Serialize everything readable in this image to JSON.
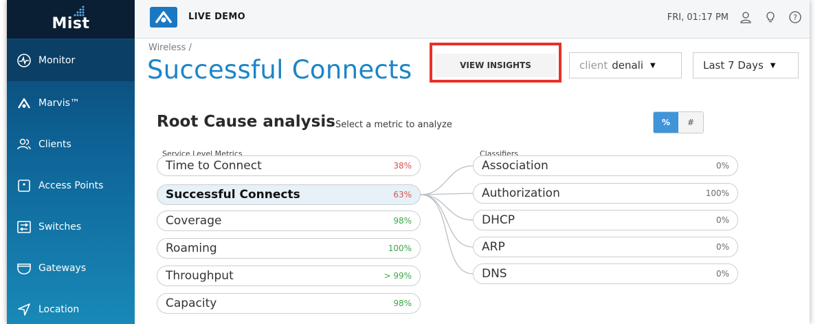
{
  "brand": {
    "name": "Mist"
  },
  "sidebar": {
    "items": [
      {
        "label": "Monitor",
        "icon": "monitor-icon"
      },
      {
        "label": "Marvis™",
        "icon": "marvis-icon"
      },
      {
        "label": "Clients",
        "icon": "clients-icon"
      },
      {
        "label": "Access Points",
        "icon": "access-point-icon"
      },
      {
        "label": "Switches",
        "icon": "switches-icon"
      },
      {
        "label": "Gateways",
        "icon": "gateways-icon"
      },
      {
        "label": "Location",
        "icon": "location-icon"
      }
    ]
  },
  "topbar": {
    "demo_label": "LIVE DEMO",
    "datetime": "FRI, 01:17 PM"
  },
  "header": {
    "breadcrumb": "Wireless /",
    "title": "Successful Connects",
    "insights_button": "VIEW INSIGHTS",
    "client_filter": {
      "prefix": "client",
      "value": "denali"
    },
    "range_filter": "Last 7 Days"
  },
  "rca": {
    "title": "Root Cause analysis",
    "subtitle": "Select a metric to analyze",
    "toggle": {
      "percent": "%",
      "count": "#"
    },
    "metrics_label": "Service Level Metrics",
    "classifiers_label": "Classifiers",
    "metrics": [
      {
        "name": "Time to Connect",
        "value": "38%"
      },
      {
        "name": "Successful Connects",
        "value": "63%"
      },
      {
        "name": "Coverage",
        "value": "98%"
      },
      {
        "name": "Roaming",
        "value": "100%"
      },
      {
        "name": "Throughput",
        "value": "> 99%"
      },
      {
        "name": "Capacity",
        "value": "98%"
      }
    ],
    "classifiers": [
      {
        "name": "Association",
        "value": "0%"
      },
      {
        "name": "Authorization",
        "value": "100%"
      },
      {
        "name": "DHCP",
        "value": "0%"
      },
      {
        "name": "ARP",
        "value": "0%"
      },
      {
        "name": "DNS",
        "value": "0%"
      }
    ]
  },
  "colors": {
    "accent": "#1b85c8",
    "highlight_box": "#e8302a",
    "bad": "#d9534f",
    "good": "#3aa84a"
  }
}
